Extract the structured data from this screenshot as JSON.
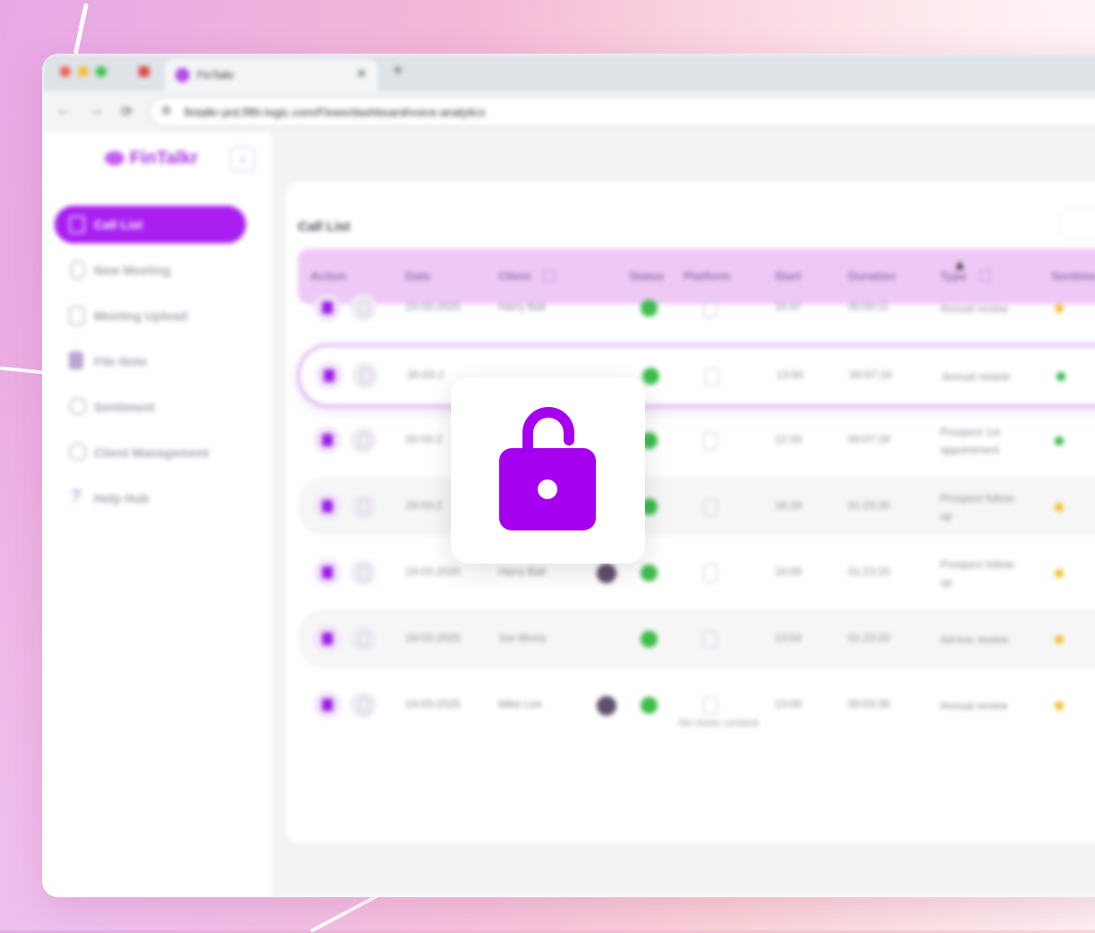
{
  "browser": {
    "tab_title": "FinTalkr",
    "url": "fintalkr-prd.fifth-logic.com/Flows/dashboard/voice-analytics"
  },
  "app": {
    "logo_text": "FinTalkr",
    "sidebar": {
      "items": [
        {
          "label": "Call List",
          "icon": "list-icon",
          "active": true
        },
        {
          "label": "New Meeting",
          "icon": "microphone-icon",
          "active": false
        },
        {
          "label": "Meeting Upload",
          "icon": "document-upload-icon",
          "active": false
        },
        {
          "label": "File Note",
          "icon": "clipboard-icon",
          "active": false
        },
        {
          "label": "Sentiment",
          "icon": "sentiment-icon",
          "active": false
        },
        {
          "label": "Client Management",
          "icon": "users-icon",
          "active": false
        },
        {
          "label": "Help Hub",
          "icon": "help-icon",
          "active": false
        }
      ]
    },
    "call_list": {
      "title": "Call List",
      "columns": [
        "Action",
        "Date",
        "Client",
        "Status",
        "Platform",
        "Start",
        "Duration",
        "Type",
        "Sentime"
      ],
      "rows": [
        {
          "date": "23-03-2025",
          "client": "Harry Ball",
          "start": "15:47",
          "duration": "00:00:11",
          "type": "Annual review",
          "sentiment_color": "#f3be2d",
          "avatar": false
        },
        {
          "date": "20-03-2",
          "client": "",
          "start": "13:50",
          "duration": "00:07:19",
          "type": "Annual review",
          "sentiment_color": "#2cb94a",
          "avatar": false
        },
        {
          "date": "20-03-2",
          "client": "",
          "start": "12:33",
          "duration": "00:07:19",
          "type": "Prospect 1st appointment",
          "sentiment_color": "#2cb94a",
          "avatar": false
        },
        {
          "date": "19-03-2",
          "client": "",
          "start": "16:19",
          "duration": "01:23:20",
          "type": "Prospect follow-up",
          "sentiment_color": "#f3be2d",
          "avatar": false
        },
        {
          "date": "19-03-2025",
          "client": "Harry Ball",
          "start": "16:09",
          "duration": "01:23:20",
          "type": "Prospect follow-up",
          "sentiment_color": "#f3be2d",
          "avatar": true
        },
        {
          "date": "19-03-2025",
          "client": "Joe Murry",
          "start": "13:54",
          "duration": "01:23:20",
          "type": "Ad-hoc review",
          "sentiment_color": "#f3be2d",
          "avatar": false
        },
        {
          "date": "19-03-2025",
          "client": "Mike Lee",
          "start": "13:00",
          "duration": "00:03:36",
          "type": "Annual review",
          "sentiment_color": "#f3be2d",
          "avatar": true
        }
      ],
      "footer": "No more content"
    }
  },
  "overlay": {
    "icon": "unlock-icon",
    "color": "#a500f0"
  }
}
